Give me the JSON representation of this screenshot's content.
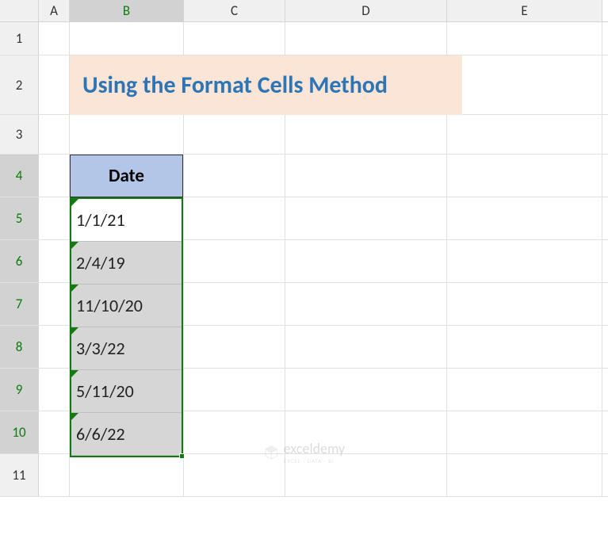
{
  "columns": {
    "A": "A",
    "B": "B",
    "C": "C",
    "D": "D",
    "E": "E"
  },
  "rows": {
    "1": "1",
    "2": "2",
    "3": "3",
    "4": "4",
    "5": "5",
    "6": "6",
    "7": "7",
    "8": "8",
    "9": "9",
    "10": "10",
    "11": "11"
  },
  "title": "Using the Format Cells Method",
  "table": {
    "header": "Date",
    "data": [
      "1/1/21",
      "2/4/19",
      "11/10/20",
      "3/3/22",
      "5/11/20",
      "6/6/22"
    ]
  },
  "watermark": {
    "brand": "exceldemy",
    "tagline": "EXCEL · DATA · BI"
  }
}
